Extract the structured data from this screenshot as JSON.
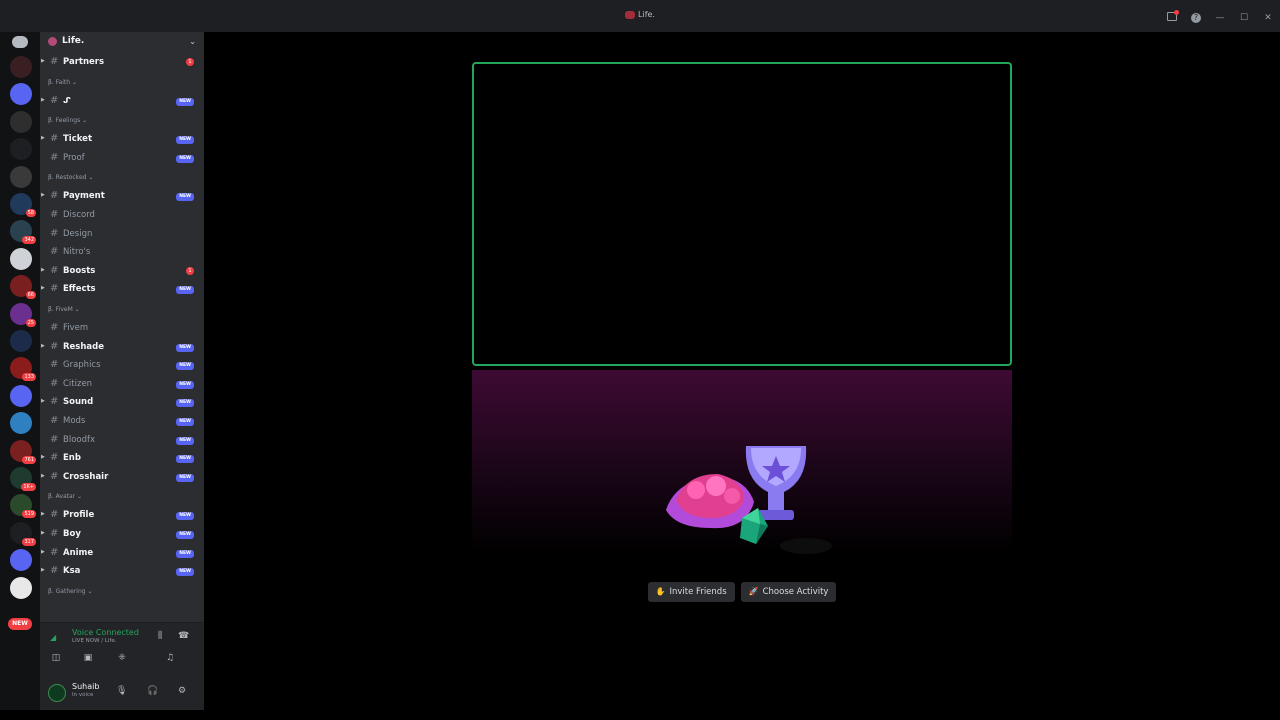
{
  "window": {
    "title": "Life."
  },
  "server": {
    "name": "Life."
  },
  "channels": [
    {
      "type": "channel",
      "name": "Partners",
      "unread": true,
      "badge": "1",
      "badge_kind": "count",
      "arrow": true
    },
    {
      "type": "category",
      "name": "Faith"
    },
    {
      "type": "channel",
      "name": "ᔑ",
      "unread": true,
      "badge": "NEW",
      "badge_kind": "new",
      "arrow": true
    },
    {
      "type": "category",
      "name": "Feelings"
    },
    {
      "type": "channel",
      "name": "Ticket",
      "unread": true,
      "badge": "NEW",
      "badge_kind": "new",
      "arrow": true
    },
    {
      "type": "channel",
      "name": "Proof",
      "unread": false,
      "badge": "NEW",
      "badge_kind": "new",
      "arrow": false
    },
    {
      "type": "category",
      "name": "Restocked"
    },
    {
      "type": "channel",
      "name": "Payment",
      "unread": true,
      "badge": "NEW",
      "badge_kind": "new",
      "arrow": true
    },
    {
      "type": "channel",
      "name": "Discord",
      "unread": false,
      "badge": "",
      "badge_kind": "",
      "arrow": false
    },
    {
      "type": "channel",
      "name": "Design",
      "unread": false,
      "badge": "",
      "badge_kind": "",
      "arrow": false
    },
    {
      "type": "channel",
      "name": "Nitro's",
      "unread": false,
      "badge": "",
      "badge_kind": "",
      "arrow": false
    },
    {
      "type": "channel",
      "name": "Boosts",
      "unread": true,
      "badge": "1",
      "badge_kind": "count",
      "arrow": true
    },
    {
      "type": "channel",
      "name": "Effects",
      "unread": true,
      "badge": "NEW",
      "badge_kind": "new",
      "arrow": true
    },
    {
      "type": "category",
      "name": "FiveM"
    },
    {
      "type": "channel",
      "name": "Fivem",
      "unread": false,
      "badge": "",
      "badge_kind": "",
      "arrow": false
    },
    {
      "type": "channel",
      "name": "Reshade",
      "unread": true,
      "badge": "NEW",
      "badge_kind": "new",
      "arrow": true
    },
    {
      "type": "channel",
      "name": "Graphics",
      "unread": false,
      "badge": "NEW",
      "badge_kind": "new",
      "arrow": false
    },
    {
      "type": "channel",
      "name": "Citizen",
      "unread": false,
      "badge": "NEW",
      "badge_kind": "new",
      "arrow": false
    },
    {
      "type": "channel",
      "name": "Sound",
      "unread": true,
      "badge": "NEW",
      "badge_kind": "new",
      "arrow": true
    },
    {
      "type": "channel",
      "name": "Mods",
      "unread": false,
      "badge": "NEW",
      "badge_kind": "new",
      "arrow": false
    },
    {
      "type": "channel",
      "name": "Bloodfx",
      "unread": false,
      "badge": "NEW",
      "badge_kind": "new",
      "arrow": false
    },
    {
      "type": "channel",
      "name": "Enb",
      "unread": true,
      "badge": "NEW",
      "badge_kind": "new",
      "arrow": true
    },
    {
      "type": "channel",
      "name": "Crosshair",
      "unread": true,
      "badge": "NEW",
      "badge_kind": "new",
      "arrow": true
    },
    {
      "type": "category",
      "name": "Avatar"
    },
    {
      "type": "channel",
      "name": "Profile",
      "unread": true,
      "badge": "NEW",
      "badge_kind": "new",
      "arrow": true
    },
    {
      "type": "channel",
      "name": "Boy",
      "unread": true,
      "badge": "NEW",
      "badge_kind": "new",
      "arrow": true
    },
    {
      "type": "channel",
      "name": "Anime",
      "unread": true,
      "badge": "NEW",
      "badge_kind": "new",
      "arrow": true
    },
    {
      "type": "channel",
      "name": "Ksa",
      "unread": true,
      "badge": "NEW",
      "badge_kind": "new",
      "arrow": true
    },
    {
      "type": "category",
      "name": "Gathering"
    }
  ],
  "rail": {
    "servers": [
      {
        "color": "#3a1f22",
        "badge": ""
      },
      {
        "color": "#5865f2",
        "badge": ""
      },
      {
        "color": "#2e2e2e",
        "badge": ""
      },
      {
        "color": "#1e1f22",
        "badge": ""
      },
      {
        "color": "#3a3a3a",
        "badge": ""
      },
      {
        "color": "#203a5c",
        "badge": "58"
      },
      {
        "color": "#2a4250",
        "badge": "342"
      },
      {
        "color": "#cfd2d6",
        "badge": ""
      },
      {
        "color": "#7a1f1f",
        "badge": "66"
      },
      {
        "color": "#6b2f8f",
        "badge": "25"
      },
      {
        "color": "#1d2b4a",
        "badge": ""
      },
      {
        "color": "#8a1c1c",
        "badge": "133"
      },
      {
        "color": "#5865f2",
        "badge": ""
      },
      {
        "color": "#2f80c0",
        "badge": ""
      },
      {
        "color": "#7a2020",
        "badge": "761"
      },
      {
        "color": "#1f3a2f",
        "badge": "1K+"
      },
      {
        "color": "#2b4a2b",
        "badge": "519"
      },
      {
        "color": "#1e1f22",
        "badge": "317"
      },
      {
        "color": "#5865f2",
        "badge": ""
      },
      {
        "color": "#e8e8e8",
        "badge": ""
      }
    ],
    "new_label": "NEW"
  },
  "voice": {
    "status": "Voice Connected",
    "location": "LIVE NOW / Life."
  },
  "user": {
    "name": "Suhaib",
    "status": "In voice"
  },
  "activity": {
    "invite_label": "Invite Friends",
    "choose_label": "Choose Activity"
  },
  "colors": {
    "accent_green": "#23a55a",
    "blurple": "#5865f2",
    "danger": "#f23f43"
  }
}
